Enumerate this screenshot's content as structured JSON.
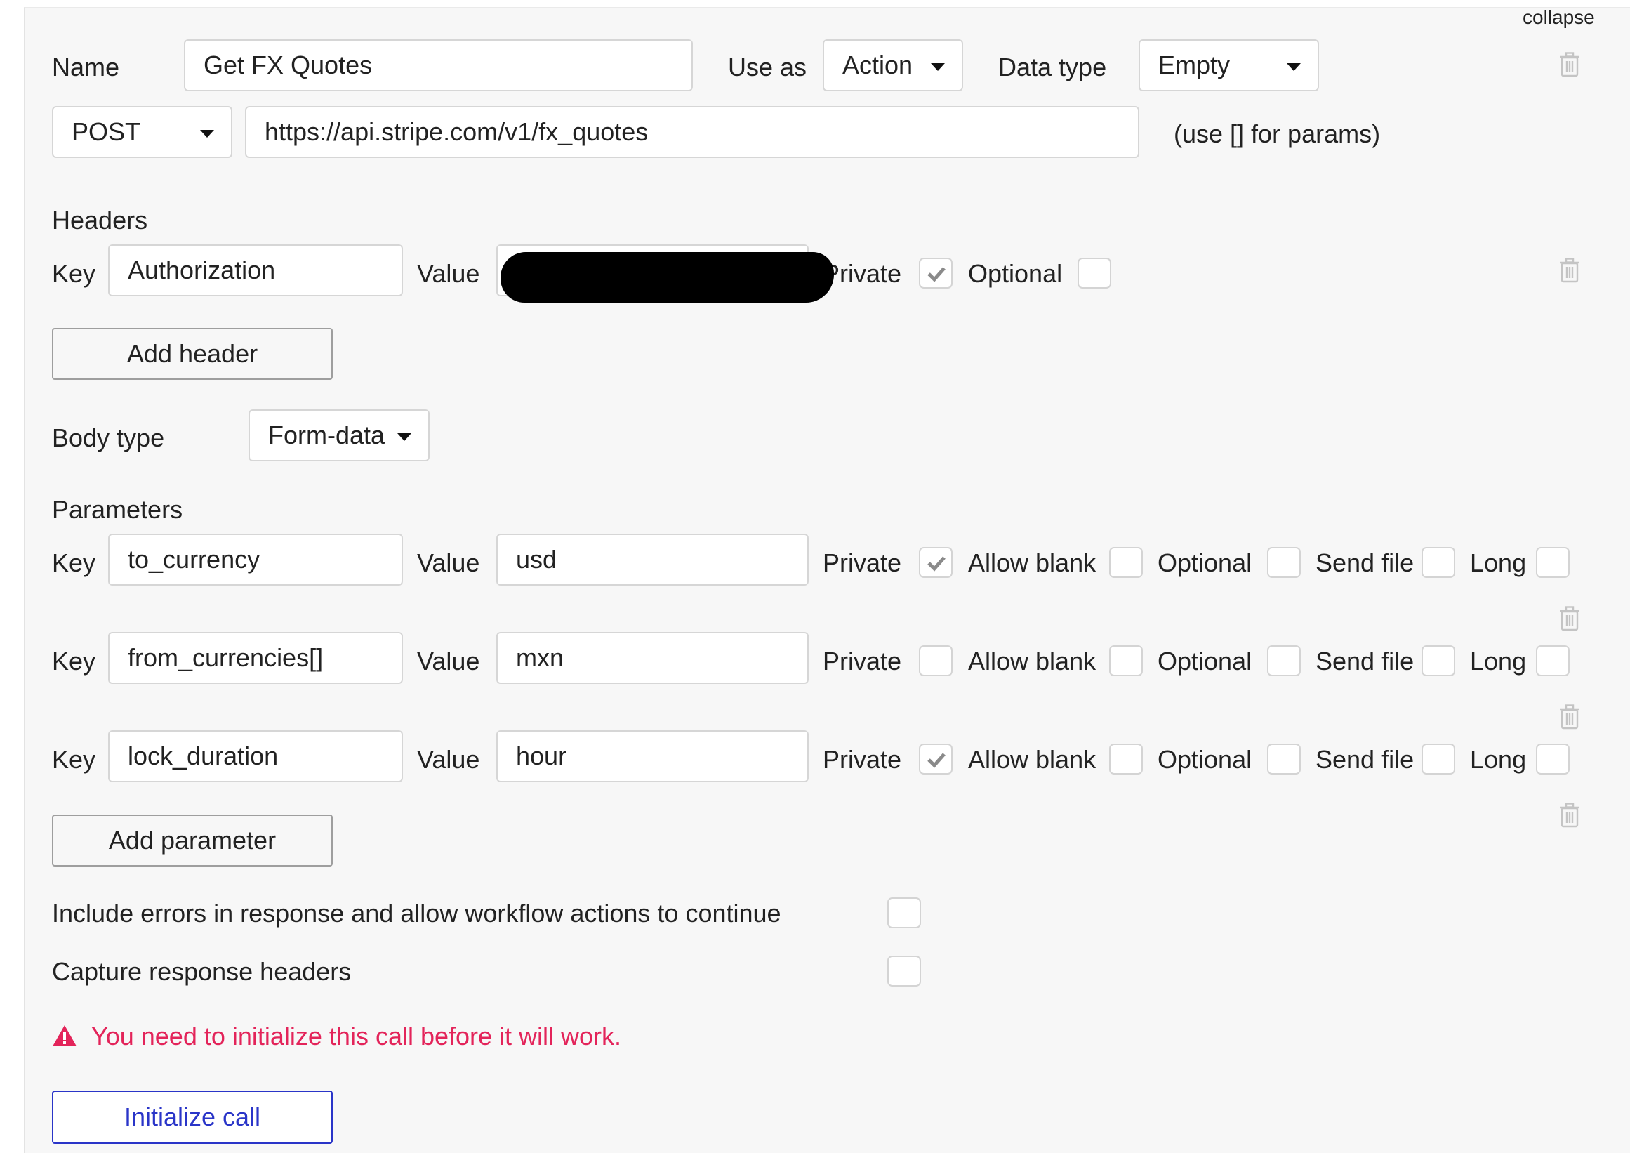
{
  "collapse_label": "collapse",
  "call": {
    "name_label": "Name",
    "name_value": "Get FX Quotes",
    "use_as_label": "Use as",
    "use_as_value": "Action",
    "data_type_label": "Data type",
    "data_type_value": "Empty",
    "method": "POST",
    "url": "https://api.stripe.com/v1/fx_quotes",
    "url_hint": "(use [] for params)"
  },
  "headers": {
    "title": "Headers",
    "rows": [
      {
        "key_label": "Key",
        "key": "Authorization",
        "value_label": "Value",
        "value_redacted": true,
        "private_label": "Private",
        "private": true,
        "optional_label": "Optional",
        "optional": false
      }
    ],
    "add_label": "Add header"
  },
  "body": {
    "type_label": "Body type",
    "type_value": "Form-data"
  },
  "parameters": {
    "title": "Parameters",
    "rows": [
      {
        "key_label": "Key",
        "key": "to_currency",
        "value_label": "Value",
        "value": "usd",
        "private_label": "Private",
        "private": true,
        "allow_blank_label": "Allow blank",
        "allow_blank": false,
        "optional_label": "Optional",
        "optional": false,
        "send_file_label": "Send file",
        "send_file": false,
        "long_label": "Long",
        "long": false
      },
      {
        "key_label": "Key",
        "key": "from_currencies[]",
        "value_label": "Value",
        "value": "mxn",
        "private_label": "Private",
        "private": false,
        "allow_blank_label": "Allow blank",
        "allow_blank": false,
        "optional_label": "Optional",
        "optional": false,
        "send_file_label": "Send file",
        "send_file": false,
        "long_label": "Long",
        "long": false
      },
      {
        "key_label": "Key",
        "key": "lock_duration",
        "value_label": "Value",
        "value": "hour",
        "private_label": "Private",
        "private": true,
        "allow_blank_label": "Allow blank",
        "allow_blank": false,
        "optional_label": "Optional",
        "optional": false,
        "send_file_label": "Send file",
        "send_file": false,
        "long_label": "Long",
        "long": false
      }
    ],
    "add_label": "Add parameter"
  },
  "options": {
    "include_errors_label": "Include errors in response and allow workflow actions to continue",
    "include_errors": false,
    "capture_headers_label": "Capture response headers",
    "capture_headers": false
  },
  "warning": {
    "icon": "warning-triangle-icon",
    "text": "You need to initialize this call before it will work."
  },
  "initialize_label": "Initialize call",
  "colors": {
    "panel_bg": "#f7f7f7",
    "warning": "#e3245a",
    "primary": "#2a35c8",
    "check": "#8a8a8a"
  }
}
